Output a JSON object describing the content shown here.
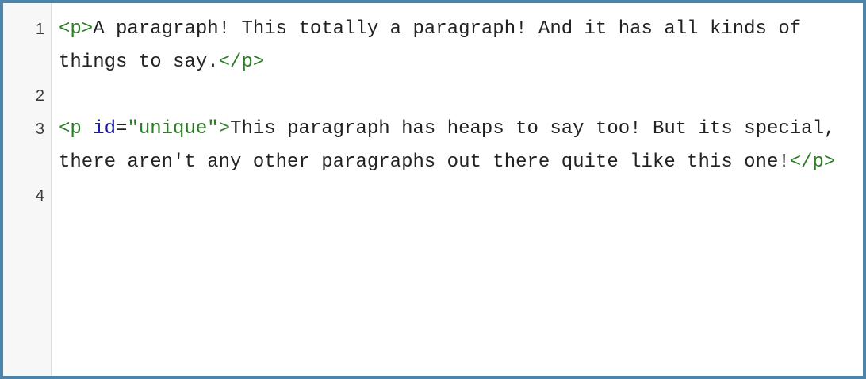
{
  "editor": {
    "lines": [
      {
        "number": "1",
        "tokens": {
          "open_tag": "<p>",
          "text": "A paragraph! This totally a paragraph! And it has all kinds of things to say.",
          "close_tag": "</p>"
        }
      },
      {
        "number": "2"
      },
      {
        "number": "3",
        "tokens": {
          "open_tag_start": "<p",
          "space": " ",
          "attr_name": "id",
          "equals": "=",
          "attr_value": "\"unique\"",
          "open_tag_end": ">",
          "text": "This paragraph has heaps to say too! But its special, there aren't any other paragraphs out there quite like this one!",
          "close_tag": "</p>"
        }
      },
      {
        "number": "4"
      }
    ],
    "colors": {
      "tag": "#2d7c27",
      "attribute": "#1a1aa6",
      "text": "#222222",
      "gutter_background": "#f7f7f7",
      "frame_border": "#4e84a8"
    }
  }
}
